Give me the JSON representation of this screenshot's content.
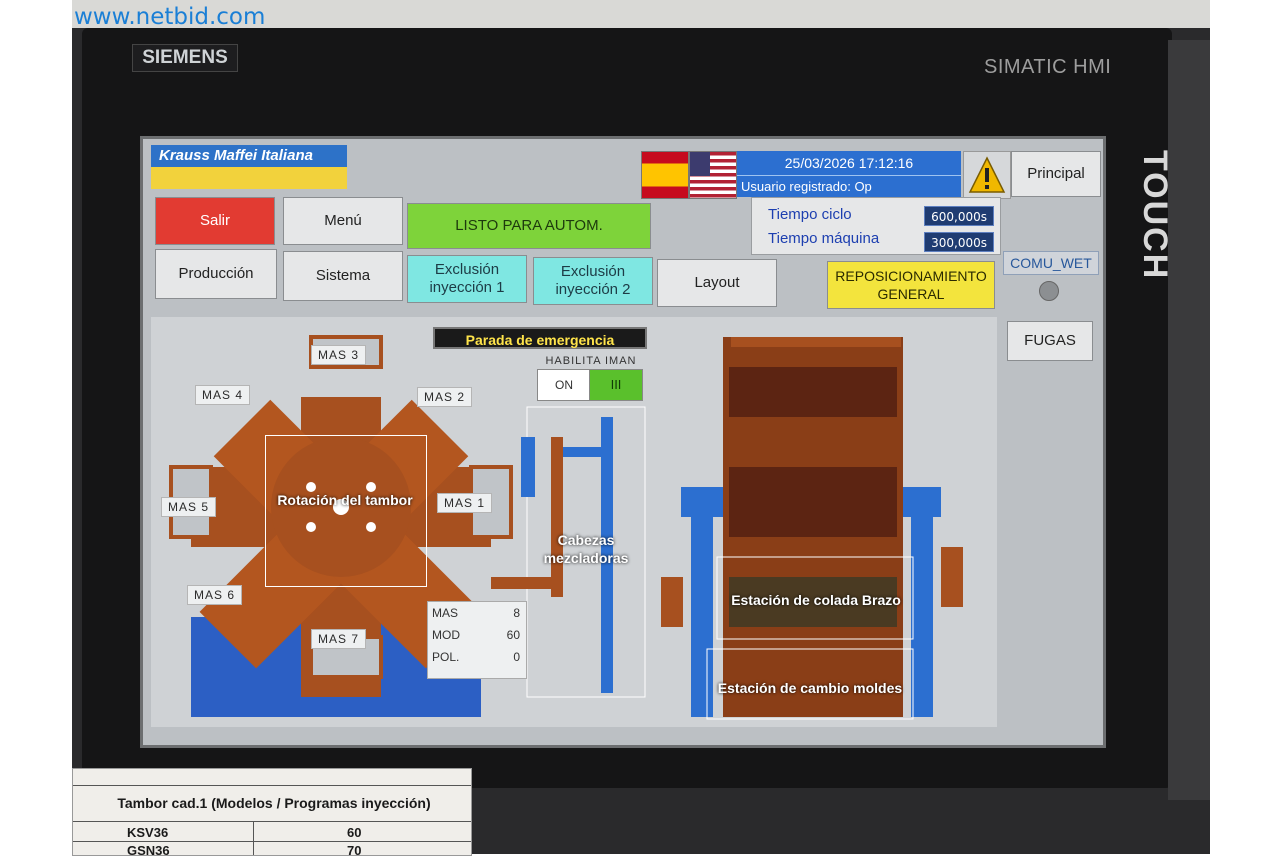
{
  "watermark": "www.netbid.com",
  "device": {
    "brand_logo": "SIEMENS",
    "model": "SIMATIC HMI",
    "side_label": "TOUCH"
  },
  "header": {
    "company": "Krauss Maffei Italiana",
    "datetime": "25/03/2026 17:12:16",
    "user": "Usuario registrado: Op",
    "principal_label": "Principal"
  },
  "buttons": {
    "salir": "Salir",
    "menu": "Menú",
    "listo": "LISTO PARA AUTOM.",
    "produccion": "Producción",
    "sistema": "Sistema",
    "exclusion1": "Exclusión inyección 1",
    "exclusion2": "Exclusión inyección 2",
    "layout": "Layout",
    "reposicionamiento": "REPOSICIONAMIENTO GENERAL",
    "fugas": "FUGAS"
  },
  "times": {
    "ciclo_label": "Tiempo ciclo",
    "ciclo_value": "600,000s",
    "maquina_label": "Tiempo máquina",
    "maquina_value": "300,000s"
  },
  "comu_wet": "COMU_WET",
  "diagram": {
    "emergency": "Parada de emergencia",
    "iman_title": "HABILITA  IMAN",
    "iman_on": "ON",
    "iman_off": "III",
    "stations": [
      "MAS  3",
      "MAS  4",
      "MAS  2",
      "MAS  5",
      "MAS  1",
      "MAS  6",
      "MAS  7"
    ],
    "drum_label": "Rotación del tambor",
    "heads_label": "Cabezas mezcladoras",
    "pour_station": "Estación de colada Brazo",
    "mold_change_station": "Estación de cambio moldes",
    "info": {
      "mas_label": "MAS",
      "mas_value": "8",
      "mod_label": "MOD",
      "mod_value": "60",
      "pol_label": "POL.",
      "pol_value": "0"
    }
  },
  "sheet": {
    "title": "Tambor cad.1 (Modelos / Programas inyección)",
    "rows": [
      {
        "model": "KSV36",
        "value": "60"
      },
      {
        "model": "GSN36",
        "value": "70"
      }
    ]
  }
}
